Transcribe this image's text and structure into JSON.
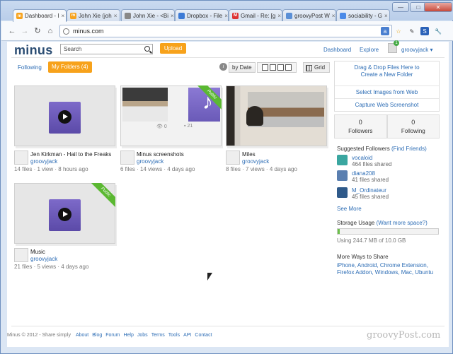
{
  "browser": {
    "tabs": [
      {
        "label": "Dashboard - I",
        "color": "#f7a21b",
        "glyph": "m",
        "active": true
      },
      {
        "label": "John Xie (joh",
        "color": "#f7a21b",
        "glyph": "m"
      },
      {
        "label": "John Xie - <Bi",
        "color": "#888888",
        "glyph": ""
      },
      {
        "label": "Dropbox - File",
        "color": "#3d7bd6",
        "glyph": ""
      },
      {
        "label": "Gmail - Re: [g",
        "color": "#d33",
        "glyph": "M"
      },
      {
        "label": "groovyPost W",
        "color": "#5a8fd6",
        "glyph": ""
      },
      {
        "label": "sociability - G",
        "color": "#4a8ae8",
        "glyph": ""
      }
    ],
    "url": "minus.com",
    "win_min": "—",
    "win_max": "□",
    "win_close": "✕"
  },
  "header": {
    "logo": "minus",
    "search_placeholder": "Search",
    "upload_label": "Upload",
    "dashboard_link": "Dashboard",
    "explore_link": "Explore",
    "username": "groovyjack",
    "notification_count": "1"
  },
  "filters": {
    "following_label": "Following",
    "my_folders_label": "My Folders (4)",
    "info_glyph": "i",
    "sort_label": "by Date",
    "grid_label": "Grid"
  },
  "folders": [
    {
      "title": "Jen Kirkman - Hail to the Freaks",
      "owner": "groovyjack",
      "files": "14 files",
      "views": "1 view",
      "age": "8 hours ago",
      "kind": "music",
      "public": false
    },
    {
      "title": "Minus screenshots",
      "owner": "groovyjack",
      "files": "6 files",
      "views": "14 views",
      "age": "4 days ago",
      "kind": "screens",
      "public": true,
      "ribbon": "Public",
      "counts": [
        "0",
        "21"
      ]
    },
    {
      "title": "Miles",
      "owner": "groovyjack",
      "files": "8 files",
      "views": "7 views",
      "age": "4 days ago",
      "kind": "photo",
      "public": false
    },
    {
      "title": "Music",
      "owner": "groovyjack",
      "files": "21 files",
      "views": "5 views",
      "age": "4 days ago",
      "kind": "music",
      "public": true,
      "ribbon": "Public"
    }
  ],
  "sidebar": {
    "drop_line1": "Drag & Drop Files Here to",
    "drop_line2": "Create a New Folder",
    "select_web": "Select Images from Web",
    "capture_web": "Capture Web Screenshot",
    "followers_count": "0",
    "followers_label": "Followers",
    "following_count": "0",
    "following_label": "Following",
    "suggested_heading": "Suggested Followers",
    "find_friends": "(Find Friends)",
    "suggested": [
      {
        "name": "vocaloid",
        "sub": "464 files shared",
        "color": "#3aa6a0"
      },
      {
        "name": "diana208",
        "sub": "41 files shared",
        "color": "#5a7fb0"
      },
      {
        "name": "M_Ordinateur",
        "sub": "45 files shared",
        "color": "#2f5a8a"
      }
    ],
    "see_more": "See More",
    "storage_heading": "Storage Usage",
    "storage_link": "(Want more space?)",
    "storage_text": "Using 244.7 MB of 10.0 GB",
    "storage_fraction": 0.024,
    "ways_heading": "More Ways to Share",
    "ways_line1": "iPhone, Android, Chrome Extension,",
    "ways_line2": "Firefox Addon, Windows, Mac, Ubuntu"
  },
  "footer": {
    "copyright": "Minus © 2012 - Share simply",
    "links": [
      "About",
      "Blog",
      "Forum",
      "Help",
      "Jobs",
      "Terms",
      "Tools",
      "API",
      "Contact"
    ]
  },
  "watermark": "groovyPost.com"
}
